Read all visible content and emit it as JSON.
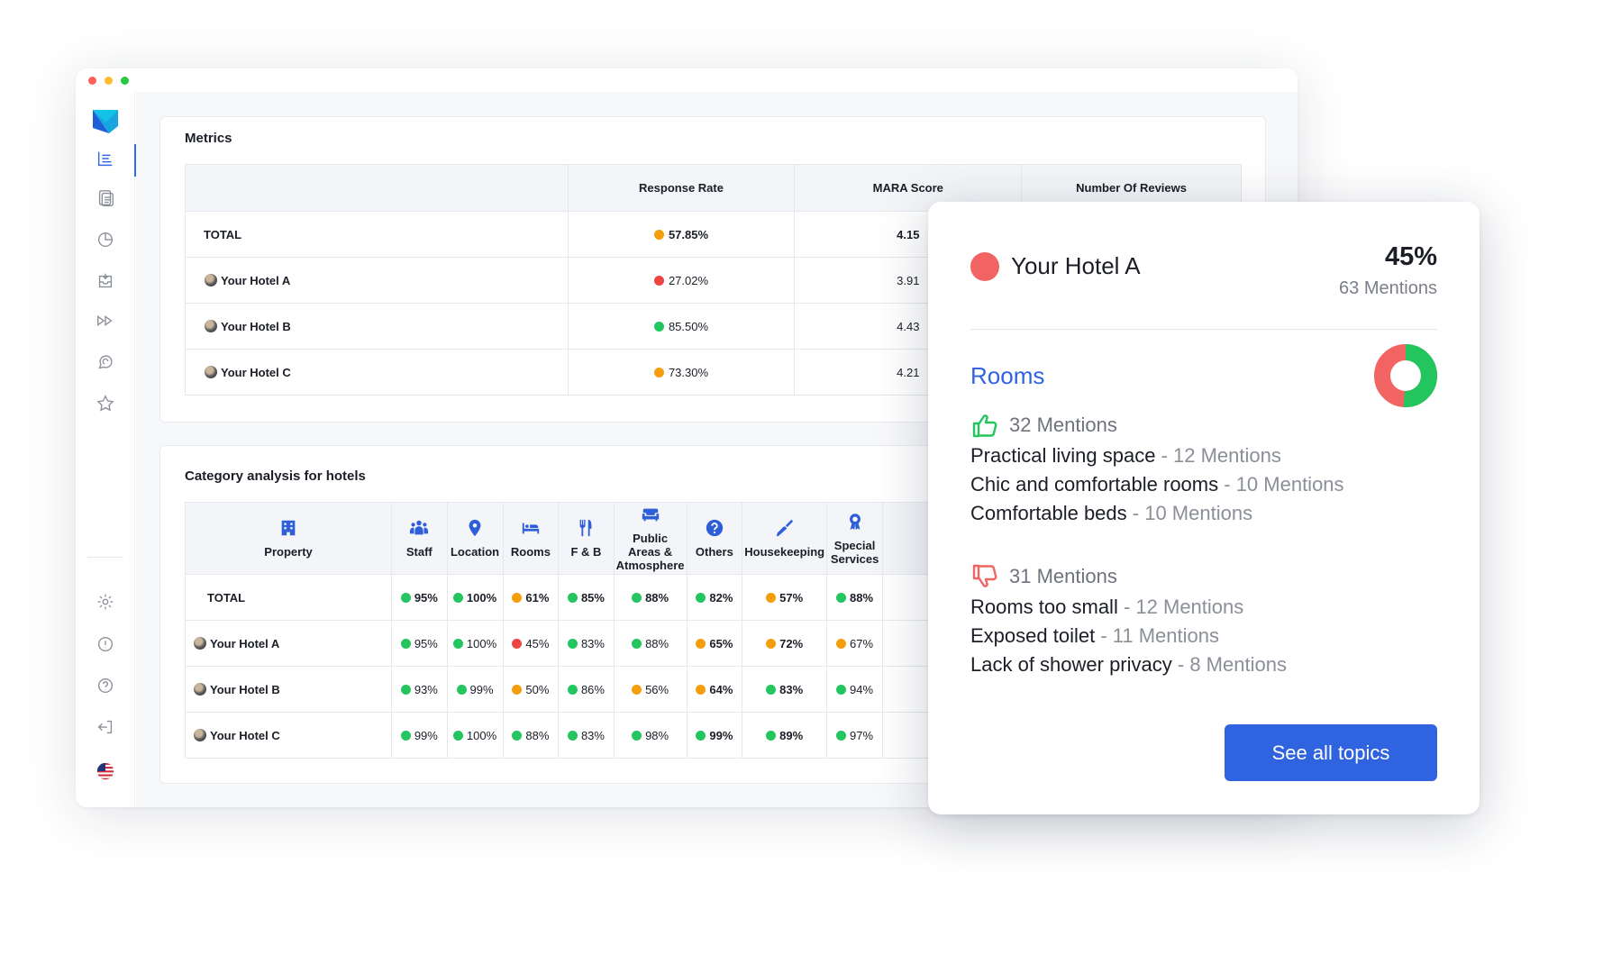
{
  "metrics": {
    "title": "Metrics",
    "columns": [
      "",
      "Response Rate",
      "MARA Score",
      "Number Of Reviews"
    ],
    "rows": [
      {
        "name": "TOTAL",
        "rate": "57.85%",
        "rate_color": "orange",
        "score": "4.15",
        "is_total": true
      },
      {
        "name": "Your Hotel A",
        "rate": "27.02%",
        "rate_color": "red",
        "score": "3.91"
      },
      {
        "name": "Your Hotel B",
        "rate": "85.50%",
        "rate_color": "green",
        "score": "4.43"
      },
      {
        "name": "Your Hotel C",
        "rate": "73.30%",
        "rate_color": "orange",
        "score": "4.21"
      }
    ]
  },
  "category": {
    "title": "Category analysis for hotels",
    "columns": [
      {
        "label": "Property",
        "icon": "building-icon"
      },
      {
        "label": "Staff",
        "icon": "staff-icon"
      },
      {
        "label": "Location",
        "icon": "location-pin-icon"
      },
      {
        "label": "Rooms",
        "icon": "bed-icon"
      },
      {
        "label": "F & B",
        "icon": "fork-knife-icon"
      },
      {
        "label": "Public Areas & Atmosphere",
        "icon": "sofa-icon"
      },
      {
        "label": "Others",
        "icon": "question-icon"
      },
      {
        "label": "Housekeeping",
        "icon": "broom-icon"
      },
      {
        "label": "Special Services",
        "icon": "award-icon"
      }
    ],
    "rows": [
      {
        "name": "TOTAL",
        "is_total": true,
        "cells": [
          {
            "v": "95%",
            "c": "green"
          },
          {
            "v": "100%",
            "c": "green"
          },
          {
            "v": "61%",
            "c": "orange"
          },
          {
            "v": "85%",
            "c": "green"
          },
          {
            "v": "88%",
            "c": "green"
          },
          {
            "v": "82%",
            "c": "green"
          },
          {
            "v": "57%",
            "c": "orange"
          },
          {
            "v": "88%",
            "c": "green"
          }
        ]
      },
      {
        "name": "Your Hotel A",
        "cells": [
          {
            "v": "95%",
            "c": "green"
          },
          {
            "v": "100%",
            "c": "green"
          },
          {
            "v": "45%",
            "c": "red"
          },
          {
            "v": "83%",
            "c": "green"
          },
          {
            "v": "88%",
            "c": "green"
          },
          {
            "v": "65%",
            "c": "orange",
            "b": true
          },
          {
            "v": "72%",
            "c": "orange",
            "b": true
          },
          {
            "v": "67%",
            "c": "orange"
          }
        ]
      },
      {
        "name": "Your Hotel B",
        "cells": [
          {
            "v": "93%",
            "c": "green"
          },
          {
            "v": "99%",
            "c": "green"
          },
          {
            "v": "50%",
            "c": "orange"
          },
          {
            "v": "86%",
            "c": "green"
          },
          {
            "v": "56%",
            "c": "orange"
          },
          {
            "v": "64%",
            "c": "orange",
            "b": true
          },
          {
            "v": "83%",
            "c": "green",
            "b": true
          },
          {
            "v": "94%",
            "c": "green"
          }
        ]
      },
      {
        "name": "Your Hotel C",
        "cells": [
          {
            "v": "99%",
            "c": "green"
          },
          {
            "v": "100%",
            "c": "green"
          },
          {
            "v": "88%",
            "c": "green"
          },
          {
            "v": "83%",
            "c": "green"
          },
          {
            "v": "98%",
            "c": "green"
          },
          {
            "v": "99%",
            "c": "green",
            "b": true
          },
          {
            "v": "89%",
            "c": "green",
            "b": true
          },
          {
            "v": "97%",
            "c": "green"
          }
        ]
      }
    ]
  },
  "popup": {
    "hotel": "Your Hotel A",
    "percent": "45%",
    "mentions": "63 Mentions",
    "topic": "Rooms",
    "donut_positive_fraction": 0.51,
    "positive": {
      "header": "32 Mentions",
      "items": [
        {
          "text": "Practical living space",
          "count": "- 12 Mentions"
        },
        {
          "text": "Chic and comfortable rooms",
          "count": "- 10 Mentions"
        },
        {
          "text": "Comfortable beds",
          "count": "- 10 Mentions"
        }
      ]
    },
    "negative": {
      "header": "31 Mentions",
      "items": [
        {
          "text": "Rooms too small",
          "count": "- 12 Mentions"
        },
        {
          "text": "Exposed toilet",
          "count": "- 11 Mentions"
        },
        {
          "text": "Lack of shower privacy",
          "count": "- 8 Mentions"
        }
      ]
    },
    "button": "See all topics"
  },
  "colors": {
    "green": "#22c55e",
    "orange": "#f59e0b",
    "red": "#ef4444",
    "accent": "#2f63e0"
  }
}
